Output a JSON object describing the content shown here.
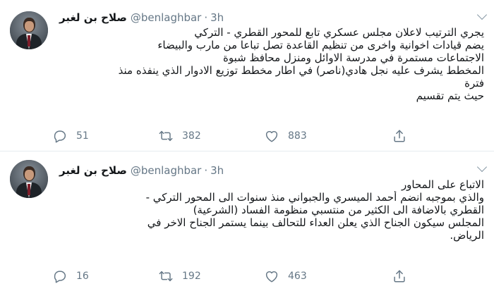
{
  "tweets": [
    {
      "author": {
        "name": "صلاح بن لغبر",
        "handle": "@benlaghbar"
      },
      "separator": "·",
      "time": "3h",
      "lines": [
        "يجري الترتيب لاعلان مجلس عسكري تابع للمحور القطري - التركي",
        "يضم قيادات اخوانية واخرى من تنظيم القاعدة تصل تباعا من مارب والبيضاء",
        "الاجتماعات مستمرة في مدرسة الاوائل ومنزل محافظ شبوة",
        "المخطط يشرف عليه نجل هادي(ناصر) في اطار مخطط توزيع الادوار الذي ينفذه منذ",
        "فترة",
        "حيث يتم تقسيم"
      ],
      "stats": {
        "replies": "51",
        "retweets": "382",
        "likes": "883"
      }
    },
    {
      "author": {
        "name": "صلاح بن لغبر",
        "handle": "@benlaghbar"
      },
      "separator": "·",
      "time": "3h",
      "lines": [
        "الاتباع على المحاور",
        "والذي بموجبه انضم أحمد الميسري والجبواني منذ سنوات الى المحور التركي -",
        "القطري بالاضافة الى الكثير من منتسبي منظومة الفساد (الشرعية)",
        "المجلس سيكون الجناح الذي يعلن العداء للتحالف بينما يستمر الجناح الاخر في",
        "الرياض."
      ],
      "stats": {
        "replies": "16",
        "retweets": "192",
        "likes": "463"
      }
    }
  ],
  "icons": {
    "reply": "reply-icon",
    "retweet": "retweet-icon",
    "like": "heart-icon",
    "share": "share-icon",
    "menu": "chevron-down-icon"
  },
  "colors": {
    "text": "#14171a",
    "secondary": "#657786",
    "divider": "#e6ecf0"
  }
}
